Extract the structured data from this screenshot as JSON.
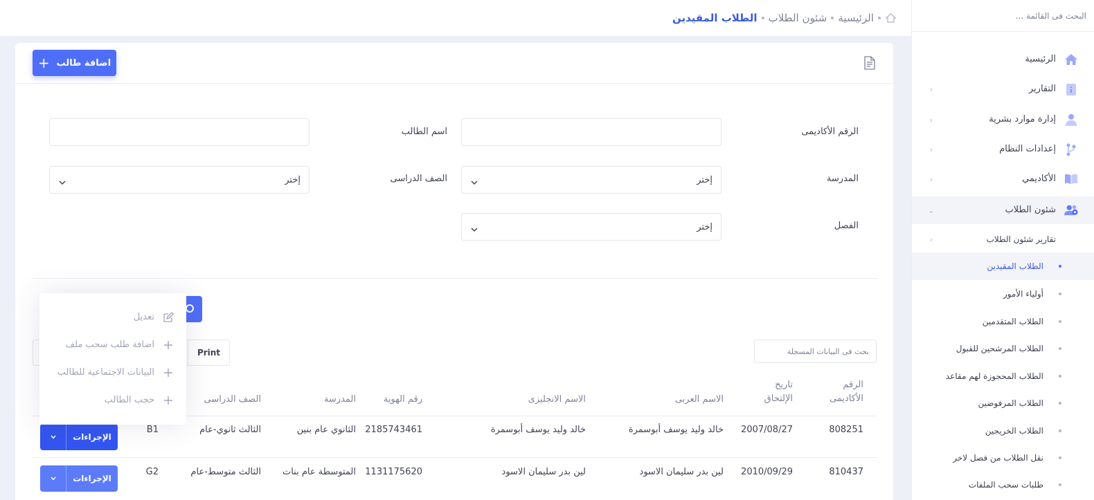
{
  "sidebar": {
    "search_placeholder": "البحث فى القائمة ...",
    "items": [
      {
        "label": "الرئيسية",
        "icon": "home-icon"
      },
      {
        "label": "التقارير",
        "icon": "report-icon"
      },
      {
        "label": "إدارة موارد بشرية",
        "icon": "user-icon"
      },
      {
        "label": "إعدادات النظام",
        "icon": "branch-icon"
      },
      {
        "label": "الأكاديمي",
        "icon": "book-icon"
      },
      {
        "label": "شئون الطلاب",
        "icon": "users-gear-icon"
      }
    ],
    "submenu": [
      {
        "label": "تقارير شئون الطلاب"
      },
      {
        "label": "الطلاب المقيدين"
      },
      {
        "label": "أولياء الأمور"
      },
      {
        "label": "الطلاب المتقدمين"
      },
      {
        "label": "الطلاب المرشحين للقبول"
      },
      {
        "label": "الطلاب المحجوزة لهم مقاعد"
      },
      {
        "label": "الطلاب المرفوضين"
      },
      {
        "label": "الطلاب الخريجين"
      },
      {
        "label": "نقل الطلاب من فصل لاخر"
      },
      {
        "label": "طلبات سحب الملفات"
      }
    ]
  },
  "breadcrumb": {
    "home": "الرئيسية",
    "section": "شئون الطلاب",
    "current": "الطلاب المقيدين"
  },
  "card": {
    "add_button": "اضافة طالب"
  },
  "filters": {
    "academic_no_label": "الرقم الأكاديمى",
    "student_name_label": "اسم الطالب",
    "school_label": "المدرسة",
    "grade_label": "الصف الدراسى",
    "class_label": "الفصل",
    "select_placeholder": "إختر"
  },
  "table": {
    "search_placeholder": "بحث فى البيانات المسجلة",
    "print_label": "Print",
    "headers": {
      "academic_no": [
        "الرقم",
        "الأكاديمى"
      ],
      "join_date": [
        "تاريخ",
        "الإلتحاق"
      ],
      "arabic_name": "الاسم العربى",
      "english_name": "الاسم الانجليزى",
      "id_no": "رقم الهوية",
      "school": "المدرسة",
      "grade": "الصف الدراسى"
    },
    "rows": [
      {
        "academic_no": "808251",
        "join_date": "2007/08/27",
        "arabic_name": "خالد وليد يوسف أبوسمرة",
        "english_name": "خالد وليد يوسف أبوسمرة",
        "id_no": "2185743461",
        "school": "الثانوي عام بنين",
        "grade": "الثالث ثانوي-عام",
        "section": "B1",
        "action": "الإجراءات"
      },
      {
        "academic_no": "810437",
        "join_date": "2010/09/29",
        "arabic_name": "لين بدر سليمان الاسود",
        "english_name": "لين بدر سليمان الاسود",
        "id_no": "1131175620",
        "school": "المتوسطة عام بنات",
        "grade": "الثالث متوسط-عام",
        "section": "G2",
        "action": "الإجراءات"
      }
    ]
  },
  "dropdown": {
    "items": [
      {
        "label": "تعديل",
        "icon": "edit-icon"
      },
      {
        "label": "اضافة طلب سحب ملف",
        "icon": "plus-icon"
      },
      {
        "label": "البيانات الاجتماعية للطالب",
        "icon": "plus-icon"
      },
      {
        "label": "حجب الطالب",
        "icon": "plus-icon"
      }
    ]
  },
  "colors": {
    "primary": "#4f6ef7",
    "active_text": "#3b5bdb",
    "muted": "#7e8299"
  }
}
